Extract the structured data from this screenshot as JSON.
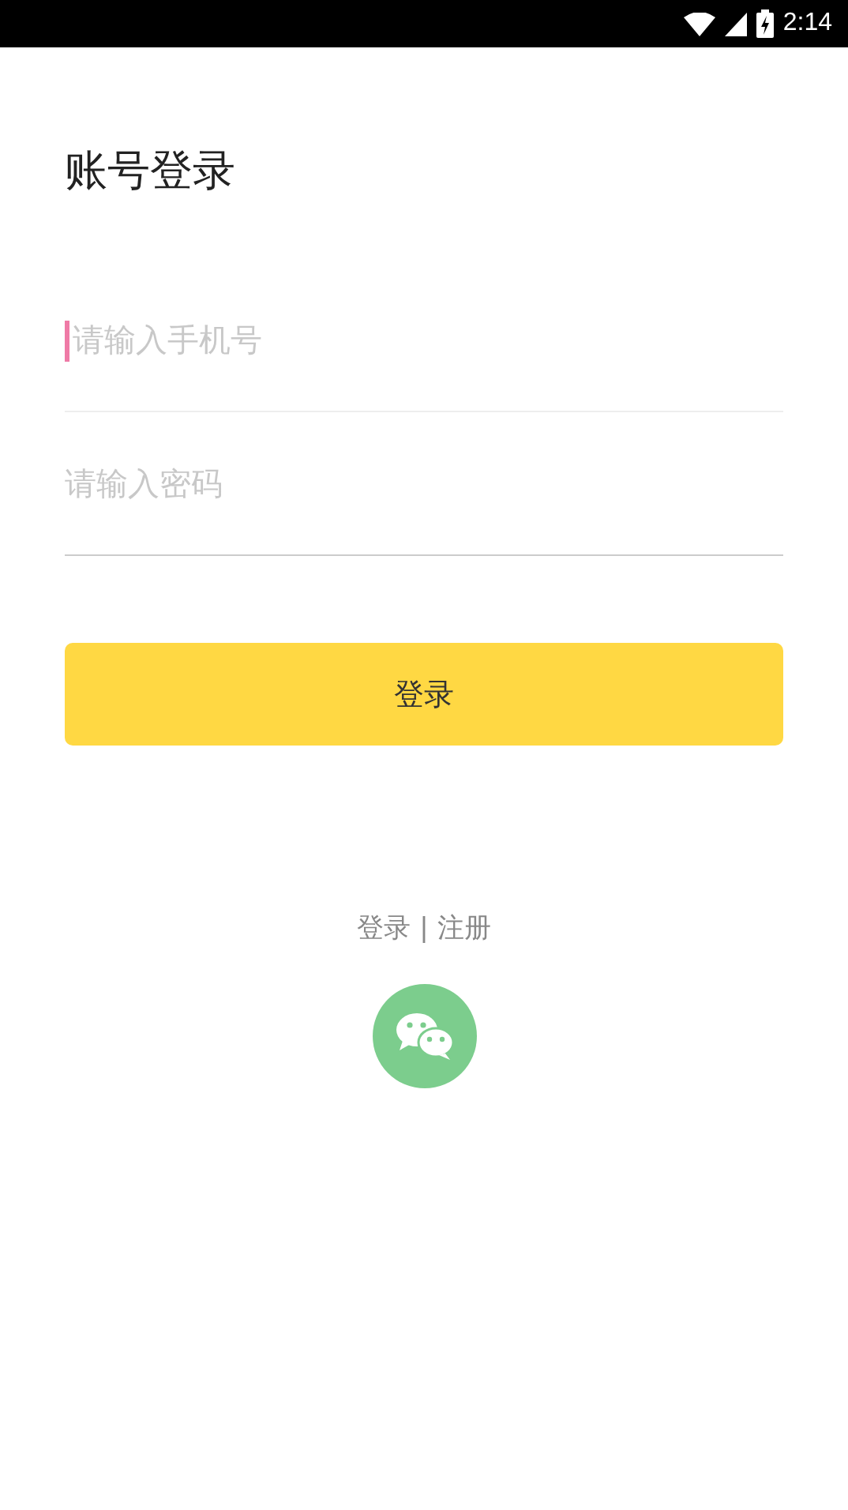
{
  "status_bar": {
    "time": "2:14"
  },
  "title": "账号登录",
  "fields": [
    {
      "placeholder": "请输入手机号",
      "focused": true
    },
    {
      "placeholder": "请输入密码",
      "focused": false
    }
  ],
  "login_button": "登录",
  "switch_link": "登录 | 注册"
}
